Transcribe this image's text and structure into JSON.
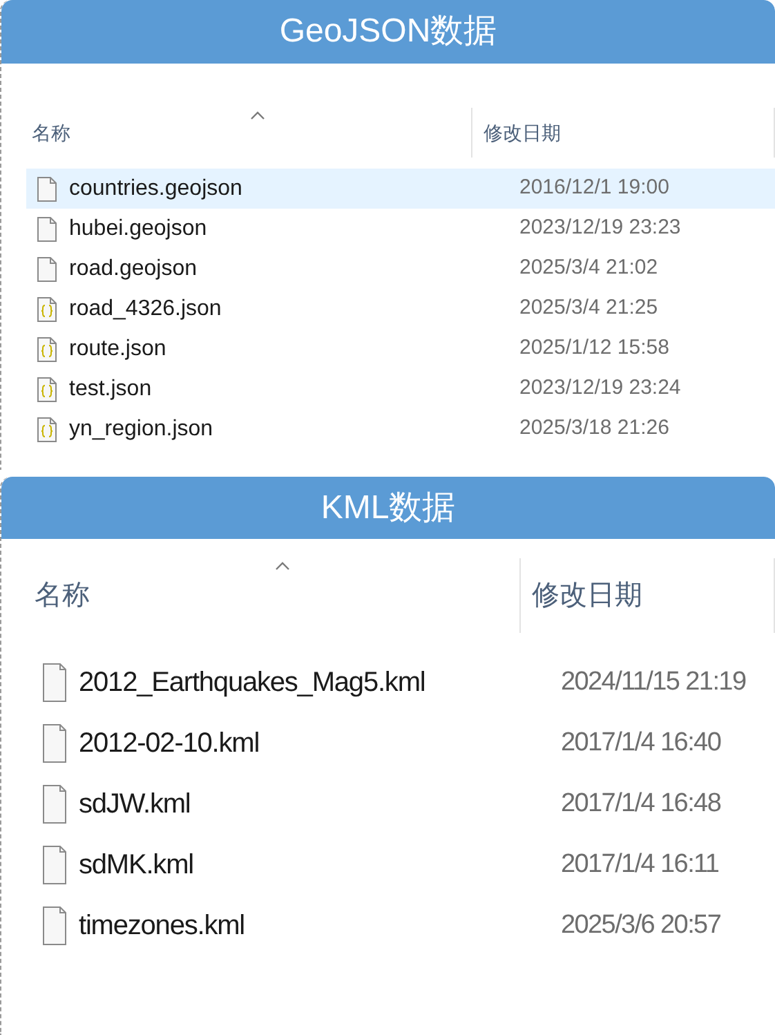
{
  "sections": [
    {
      "title": "GeoJSON数据",
      "columns": [
        {
          "label": "名称",
          "sorted": true
        },
        {
          "label": "修改日期",
          "sorted": false
        }
      ],
      "files": [
        {
          "name": "countries.geojson",
          "modified": "2016/12/1 19:00",
          "kind": "plain",
          "selected": true
        },
        {
          "name": "hubei.geojson",
          "modified": "2023/12/19 23:23",
          "kind": "plain",
          "selected": false
        },
        {
          "name": "road.geojson",
          "modified": "2025/3/4 21:02",
          "kind": "plain",
          "selected": false
        },
        {
          "name": "road_4326.json",
          "modified": "2025/3/4 21:25",
          "kind": "json",
          "selected": false
        },
        {
          "name": "route.json",
          "modified": "2025/1/12 15:58",
          "kind": "json",
          "selected": false
        },
        {
          "name": "test.json",
          "modified": "2023/12/19 23:24",
          "kind": "json",
          "selected": false
        },
        {
          "name": "yn_region.json",
          "modified": "2025/3/18 21:26",
          "kind": "json",
          "selected": false
        }
      ]
    },
    {
      "title": "KML数据",
      "columns": [
        {
          "label": "名称",
          "sorted": true
        },
        {
          "label": "修改日期",
          "sorted": false
        }
      ],
      "files": [
        {
          "name": "2012_Earthquakes_Mag5.kml",
          "modified": "2024/11/15 21:19",
          "kind": "plain",
          "selected": false
        },
        {
          "name": "2012-02-10.kml",
          "modified": "2017/1/4 16:40",
          "kind": "plain",
          "selected": false
        },
        {
          "name": "sdJW.kml",
          "modified": "2017/1/4 16:48",
          "kind": "plain",
          "selected": false
        },
        {
          "name": "sdMK.kml",
          "modified": "2017/1/4 16:11",
          "kind": "plain",
          "selected": false
        },
        {
          "name": "timezones.kml",
          "modified": "2025/3/6 20:57",
          "kind": "plain",
          "selected": false
        }
      ]
    }
  ]
}
